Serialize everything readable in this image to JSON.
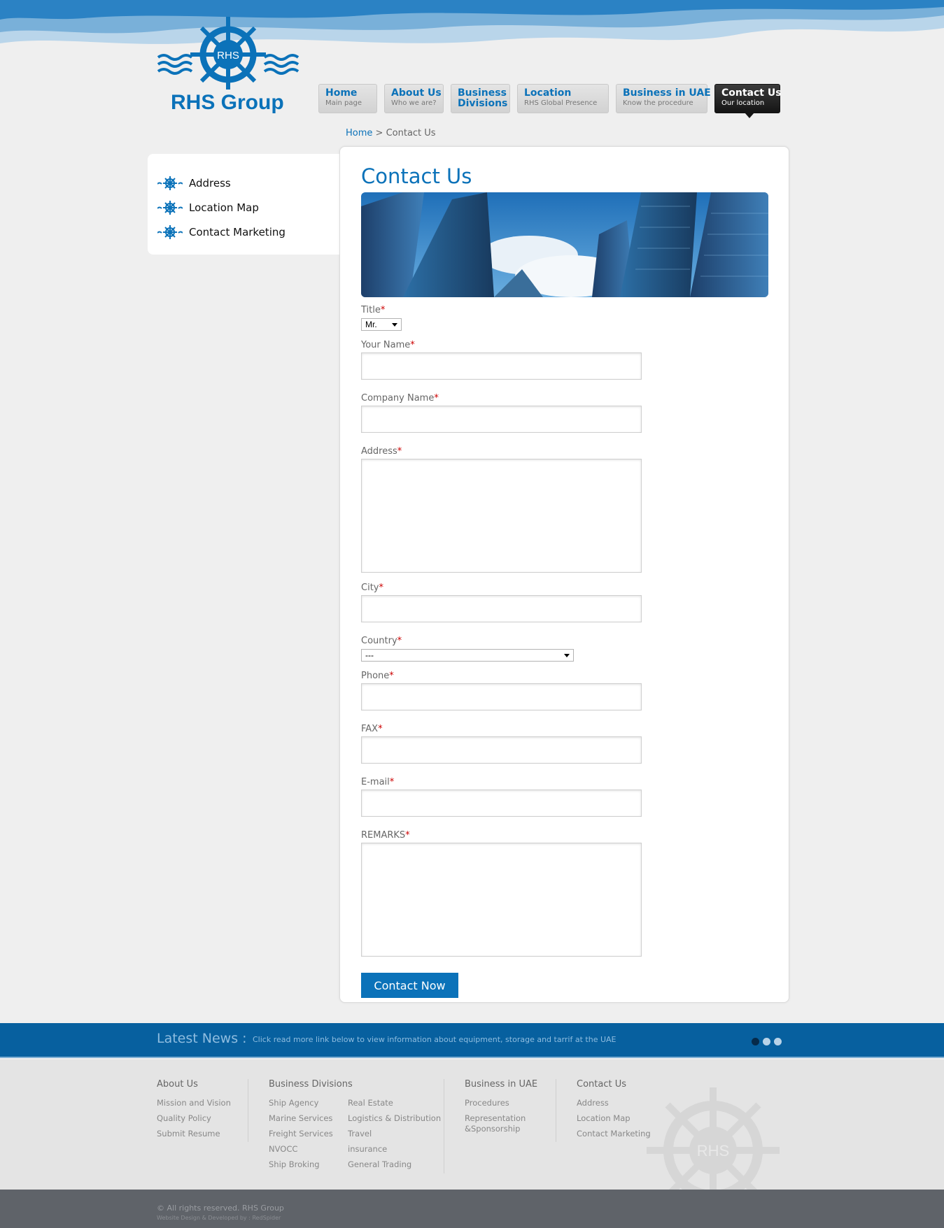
{
  "brand": {
    "logo_text": "RHS Group",
    "logo_badge": "RHS",
    "color": "#0b72b9"
  },
  "nav": [
    {
      "title": "Home",
      "subtitle": "Main page"
    },
    {
      "title": "About Us",
      "subtitle": "Who we are?"
    },
    {
      "title": "Business Divisions",
      "title_line1": "Business",
      "title_line2": "Divisions",
      "subtitle": ""
    },
    {
      "title": "Location",
      "subtitle": "RHS Global Presence"
    },
    {
      "title": "Business in UAE",
      "subtitle": "Know the procedure"
    },
    {
      "title": "Contact Us",
      "subtitle": "Our location",
      "active": true
    }
  ],
  "breadcrumb": {
    "home": "Home",
    "separator": ">",
    "current": "Contact Us"
  },
  "sidebar": {
    "items": [
      "Address",
      "Location Map",
      "Contact Marketing"
    ]
  },
  "page": {
    "title": "Contact Us"
  },
  "form": {
    "required_mark": "*",
    "title_label": "Title",
    "title_value": "Mr.",
    "name_label": "Your Name",
    "company_label": "Company Name",
    "address_label": "Address",
    "city_label": "City",
    "country_label": "Country",
    "country_value": "---",
    "phone_label": "Phone",
    "fax_label": "FAX",
    "email_label": "E-mail",
    "remarks_label": "REMARKS",
    "submit_label": "Contact Now"
  },
  "news": {
    "title": "Latest News :",
    "text": "Click read more link below to view information about equipment, storage and tarrif at the UAE",
    "dots": 3,
    "active_dot": 0
  },
  "footer": {
    "about": {
      "title": "About Us",
      "links": [
        "Mission and Vision",
        "Quality Policy",
        "Submit Resume"
      ]
    },
    "divisions": {
      "title": "Business Divisions",
      "col1": [
        "Ship Agency",
        "Marine Services",
        "Freight Services",
        "NVOCC",
        "Ship Broking"
      ],
      "col2": [
        "Real Estate",
        "Logistics & Distribution",
        "Travel",
        "insurance",
        "General Trading"
      ]
    },
    "uae": {
      "title": "Business in UAE",
      "links": [
        "Procedures",
        "Representation",
        "&Sponsorship"
      ]
    },
    "contact": {
      "title": "Contact Us",
      "links": [
        "Address",
        "Location Map",
        "Contact Marketing"
      ]
    },
    "watermark": "RHS"
  },
  "bottom": {
    "copyright": "© All rights reserved. RHS Group",
    "developer": "Website Design & Developed by : RedSpider"
  }
}
